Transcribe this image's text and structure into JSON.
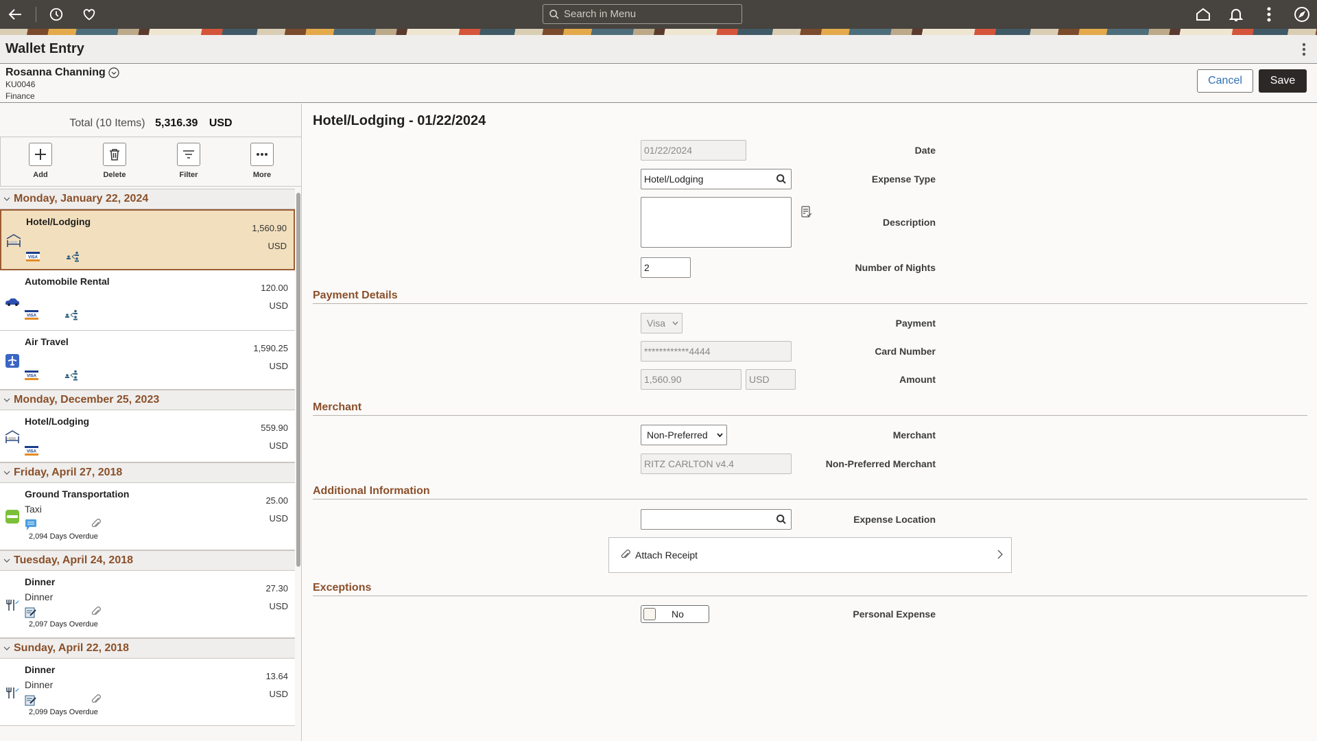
{
  "topbar": {
    "search_placeholder": "Search in Menu",
    "icons": [
      "back-arrow-icon",
      "history-icon",
      "favorites-heart-icon",
      "home-icon",
      "notifications-bell-icon",
      "actions-kebab-icon",
      "navigator-compass-icon"
    ]
  },
  "page": {
    "title": "Wallet Entry"
  },
  "employee": {
    "name": "Rosanna Channing",
    "id": "KU0046",
    "department": "Finance"
  },
  "actions": {
    "cancel_label": "Cancel",
    "save_label": "Save"
  },
  "summary": {
    "total_label": "Total (10 Items)",
    "total_amount": "5,316.39",
    "currency": "USD"
  },
  "toolbar": {
    "add": "Add",
    "delete": "Delete",
    "filter": "Filter",
    "more": "More"
  },
  "groups": [
    {
      "date": "Monday, January 22, 2024",
      "items": [
        {
          "name": "Hotel/Lodging",
          "sub": "",
          "amount": "1,560.90",
          "currency": "USD",
          "type_icon": "hotel-bed-icon",
          "payment_icon": "visa-card-icon",
          "extra_icon": "split-allocation-icon",
          "overdue": "",
          "selected": true
        },
        {
          "name": "Automobile Rental",
          "sub": "",
          "amount": "120.00",
          "currency": "USD",
          "type_icon": "car-icon",
          "payment_icon": "visa-card-icon",
          "extra_icon": "split-allocation-icon",
          "overdue": ""
        },
        {
          "name": "Air Travel",
          "sub": "",
          "amount": "1,590.25",
          "currency": "USD",
          "type_icon": "airplane-icon",
          "payment_icon": "visa-card-icon",
          "extra_icon": "split-allocation-icon",
          "overdue": ""
        }
      ]
    },
    {
      "date": "Monday, December 25, 2023",
      "items": [
        {
          "name": "Hotel/Lodging",
          "sub": "",
          "amount": "559.90",
          "currency": "USD",
          "type_icon": "hotel-bed-icon",
          "payment_icon": "visa-card-icon",
          "extra_icon": "",
          "overdue": ""
        }
      ]
    },
    {
      "date": "Friday, April 27, 2018",
      "items": [
        {
          "name": "Ground Transportation",
          "sub": "Taxi",
          "amount": "25.00",
          "currency": "USD",
          "type_icon": "taxi-icon",
          "payment_icon": "comment-icon",
          "extra_icon": "paperclip-icon",
          "overdue": "2,094 Days Overdue"
        }
      ]
    },
    {
      "date": "Tuesday, April 24, 2018",
      "items": [
        {
          "name": "Dinner",
          "sub": "Dinner",
          "amount": "27.30",
          "currency": "USD",
          "type_icon": "dining-utensils-icon",
          "payment_icon": "receipt-edit-icon",
          "extra_icon": "paperclip-icon",
          "overdue": "2,097 Days Overdue"
        }
      ]
    },
    {
      "date": "Sunday, April 22, 2018",
      "items": [
        {
          "name": "Dinner",
          "sub": "Dinner",
          "amount": "13.64",
          "currency": "USD",
          "type_icon": "dining-utensils-icon",
          "payment_icon": "receipt-edit-icon",
          "extra_icon": "paperclip-icon",
          "overdue": "2,099 Days Overdue"
        }
      ]
    }
  ],
  "detail": {
    "title": "Hotel/Lodging - 01/22/2024",
    "fields": {
      "date": {
        "label": "Date",
        "value": "01/22/2024"
      },
      "expense_type": {
        "label": "Expense Type",
        "value": "Hotel/Lodging"
      },
      "description": {
        "label": "Description",
        "value": ""
      },
      "nights": {
        "label": "Number of Nights",
        "value": "2"
      }
    },
    "sections": {
      "payment": "Payment Details",
      "merchant": "Merchant",
      "additional": "Additional Information",
      "exceptions": "Exceptions"
    },
    "payment": {
      "payment_label": "Payment",
      "payment_value": "Visa",
      "card_label": "Card Number",
      "card_value": "************4444",
      "amount_label": "Amount",
      "amount_value": "1,560.90",
      "amount_currency": "USD"
    },
    "merchant": {
      "merchant_label": "Merchant",
      "merchant_value": "Non-Preferred",
      "np_label": "Non-Preferred Merchant",
      "np_value": "RITZ CARLTON v4.4"
    },
    "additional": {
      "location_label": "Expense Location",
      "location_value": "",
      "attach_label": "Attach Receipt"
    },
    "exceptions": {
      "personal_label": "Personal Expense",
      "personal_value": "No"
    }
  },
  "colors": {
    "accent_brown": "#8a4f2a",
    "selected_bg": "#f2dfbd",
    "save_bg": "#2c2826",
    "link_blue": "#2f6fb5",
    "topbar": "#47433e"
  }
}
